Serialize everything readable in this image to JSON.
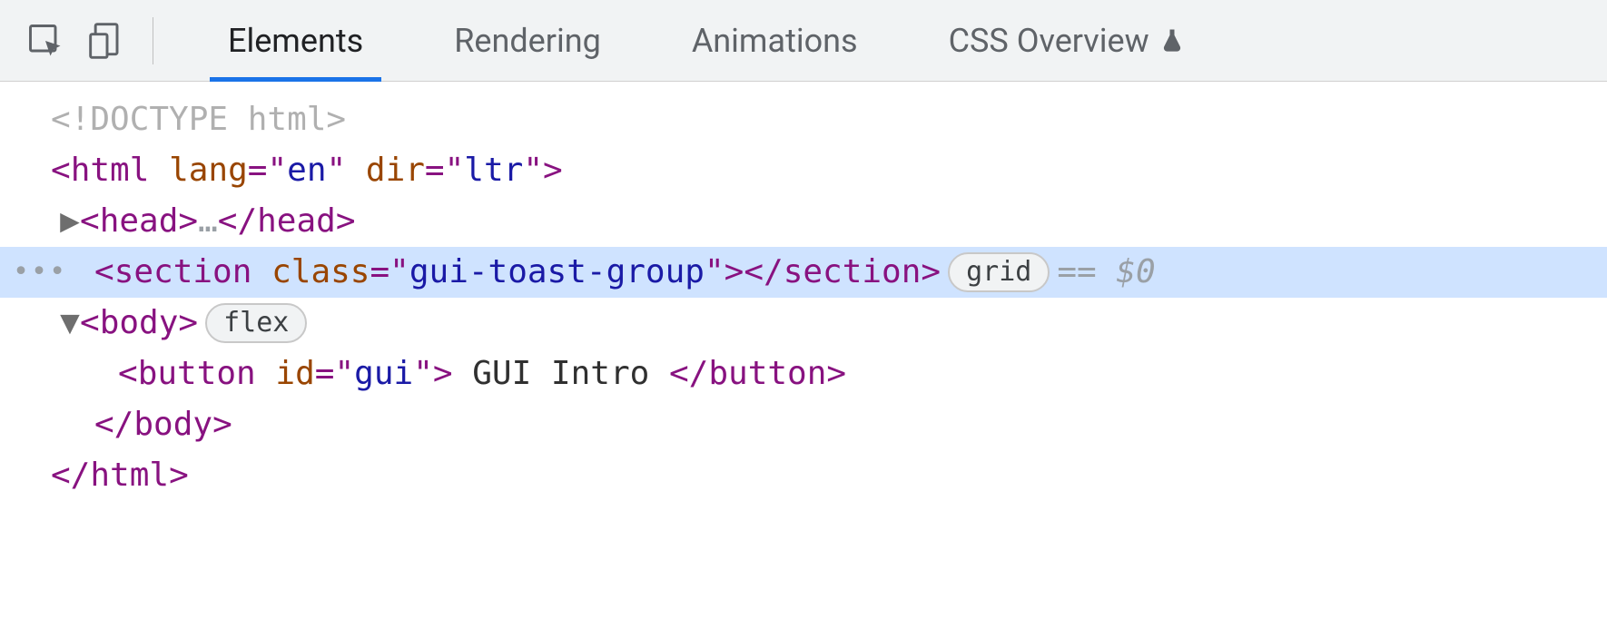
{
  "tabs": {
    "elements": "Elements",
    "rendering": "Rendering",
    "animations": "Animations",
    "overview": "CSS Overview"
  },
  "dom": {
    "doctype": "<!DOCTYPE html>",
    "html_tag": "html",
    "html_attr_lang_name": "lang",
    "html_attr_lang_val": "en",
    "html_attr_dir_name": "dir",
    "html_attr_dir_val": "ltr",
    "head_tag": "head",
    "head_ellipsis": "…",
    "section_tag": "section",
    "section_attr_class_name": "class",
    "section_attr_class_val": "gui-toast-group",
    "section_badge": "grid",
    "section_ref": "== $0",
    "body_tag": "body",
    "body_badge": "flex",
    "button_tag": "button",
    "button_attr_id_name": "id",
    "button_attr_id_val": "gui",
    "button_text": " GUI Intro ",
    "close_body": "body",
    "close_html": "html"
  }
}
